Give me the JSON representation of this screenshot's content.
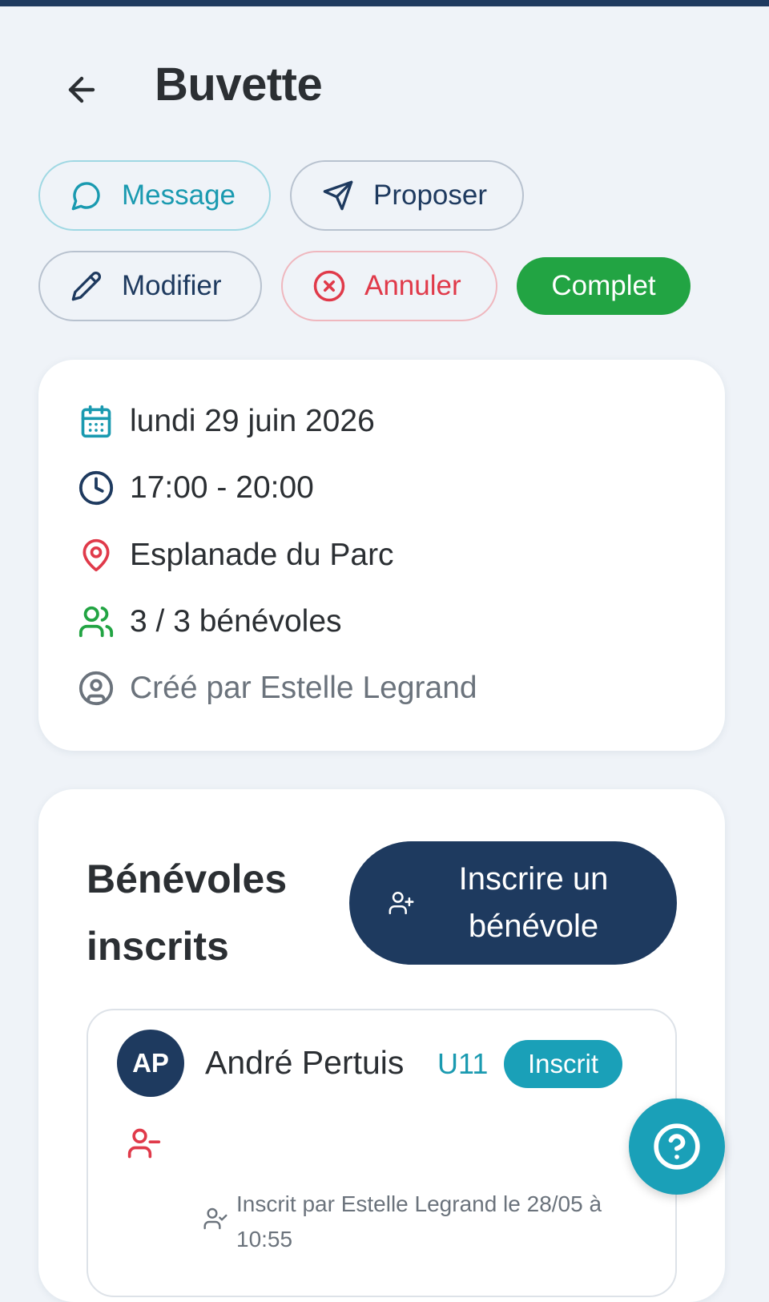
{
  "header": {
    "title": "Buvette",
    "back_icon": "arrow-left-icon"
  },
  "actions": {
    "message_label": "Message",
    "propose_label": "Proposer",
    "modify_label": "Modifier",
    "cancel_label": "Annuler",
    "status_label": "Complet"
  },
  "event": {
    "date": "lundi 29 juin 2026",
    "time": "17:00 - 20:00",
    "location": "Esplanade du Parc",
    "volunteers_count": "3 / 3 bénévoles",
    "created_by": "Créé par Estelle Legrand"
  },
  "volunteers": {
    "title": "Bénévoles inscrits",
    "signup_label": "Inscrire un bénévole",
    "items": [
      {
        "initials": "AP",
        "name": "André Pertuis",
        "team": "U11",
        "status": "Inscrit",
        "signed_by": "Inscrit par Estelle Legrand le 28/05 à 10:55"
      }
    ]
  },
  "colors": {
    "primary": "#1e3a5f",
    "accent": "#1aa0b8",
    "success": "#22a443",
    "danger": "#e03a4a",
    "background": "#eff3f8"
  }
}
